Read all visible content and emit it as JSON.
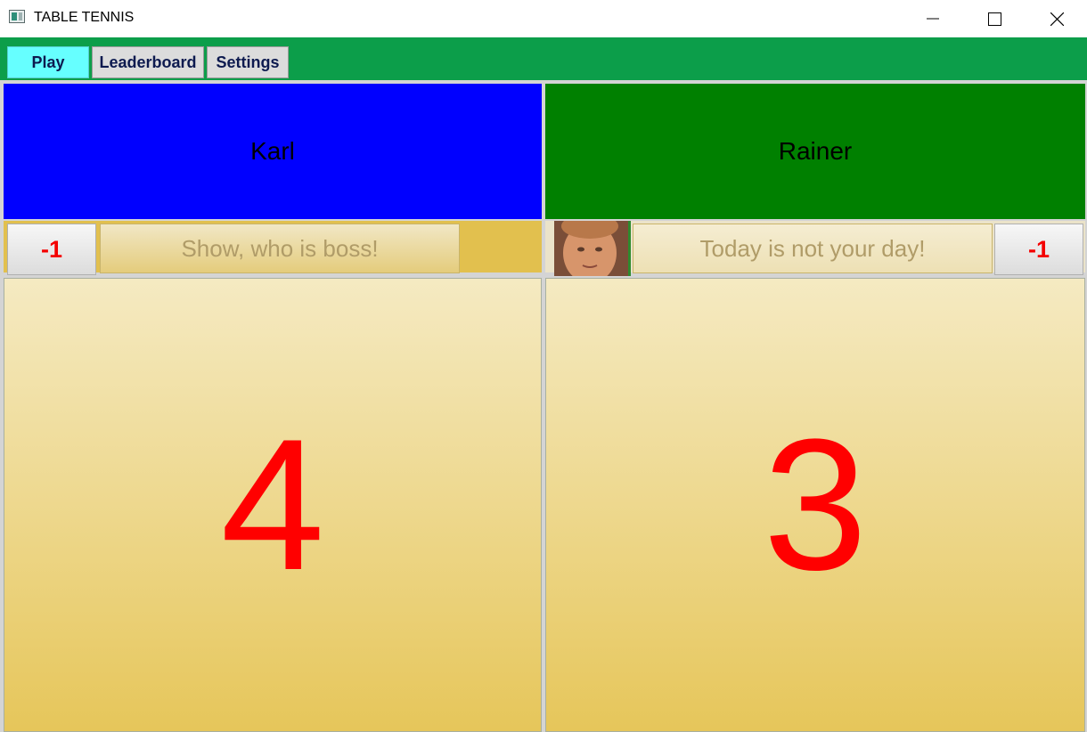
{
  "window": {
    "title": "TABLE TENNIS"
  },
  "tabs": [
    {
      "label": "Play",
      "active": true
    },
    {
      "label": "Leaderboard",
      "active": false
    },
    {
      "label": "Settings",
      "active": false
    }
  ],
  "players": {
    "left": {
      "name": "Karl",
      "color": "#0000ff",
      "minus_label": "-1",
      "slogan": "Show, who is boss!",
      "score": "4"
    },
    "right": {
      "name": "Rainer",
      "color": "#008000",
      "minus_label": "-1",
      "slogan": "Today is not your day!",
      "score": "3"
    }
  },
  "colors": {
    "tabbar": "#0c9e4a",
    "active_tab": "#66ffff",
    "score_text": "#ff0000"
  }
}
